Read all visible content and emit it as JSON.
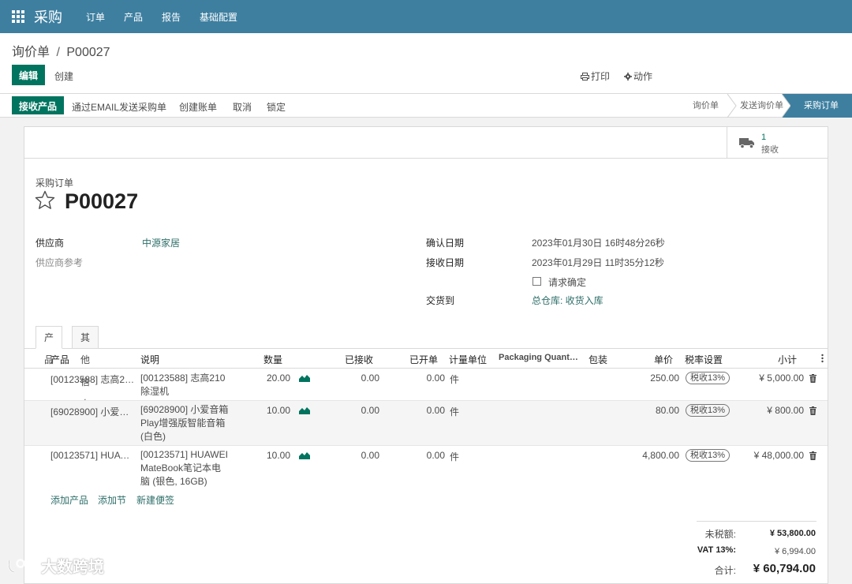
{
  "app": {
    "brand": "采购",
    "menu": [
      "订单",
      "产品",
      "报告",
      "基础配置"
    ]
  },
  "control": {
    "breadcrumb_parent": "询价单",
    "breadcrumb_sep": "/",
    "breadcrumb_current": "P00027",
    "edit_label": "编辑",
    "create_label": "创建",
    "print_label": "打印",
    "action_label": "动作"
  },
  "statusbar": {
    "buttons": [
      "接收产品",
      "通过EMAIL发送采购单",
      "创建账单",
      "取消",
      "锁定"
    ],
    "stages": [
      "询价单",
      "发送询价单",
      "采购订单"
    ],
    "active_stage": "采购订单"
  },
  "smart_button": {
    "count": "1",
    "label": "接收"
  },
  "form": {
    "doc_type": "采购订单",
    "doc_name": "P00027",
    "vendor_label": "供应商",
    "vendor_value": "中源家居",
    "vendor_ref_label": "供应商参考",
    "confirm_date_label": "确认日期",
    "confirm_date_value": "2023年01月30日 16时48分26秒",
    "receipt_date_label": "接收日期",
    "receipt_date_value": "2023年01月29日 11时35分12秒",
    "ask_confirm_label": "请求确定",
    "deliver_to_label": "交货到",
    "deliver_to_value": "总仓库: 收货入库"
  },
  "tabs": [
    "产品",
    "其他信息"
  ],
  "table": {
    "headers": [
      "产品",
      "说明",
      "数量",
      "已接收",
      "已开单",
      "计量单位",
      "Packaging Quant…",
      "包装",
      "单价",
      "税率设置",
      "小计"
    ],
    "rows": [
      {
        "product": "[00123588] 志高21…",
        "description": "[00123588] 志高210 除湿机",
        "qty": "20.00",
        "received": "0.00",
        "billed": "0.00",
        "uom": "件",
        "unit_price": "250.00",
        "tax": "税收13%",
        "subtotal": "¥ 5,000.00"
      },
      {
        "product": "[69028900] 小爱音…",
        "description": "[69028900] 小爱音箱Play增强版智能音箱 (白色)",
        "qty": "10.00",
        "received": "0.00",
        "billed": "0.00",
        "uom": "件",
        "unit_price": "80.00",
        "tax": "税收13%",
        "subtotal": "¥ 800.00"
      },
      {
        "product": "[00123571] HUAW…",
        "description": "[00123571] HUAWEI MateBook笔记本电脑 (银色, 16GB)",
        "qty": "10.00",
        "received": "0.00",
        "billed": "0.00",
        "uom": "件",
        "unit_price": "4,800.00",
        "tax": "税收13%",
        "subtotal": "¥ 48,000.00"
      }
    ],
    "add_product": "添加产品",
    "add_section": "添加节",
    "add_note": "新建便签"
  },
  "totals": {
    "untaxed_label": "未税额:",
    "untaxed_value": "¥ 53,800.00",
    "vat_label": "VAT 13%:",
    "vat_value": "¥ 6,994.00",
    "total_label": "合计:",
    "total_value": "¥ 60,794.00"
  },
  "watermark": "大数跨境",
  "colors": {
    "nav": "#3e7fa0",
    "primary": "#00745f",
    "link": "#2e6f6a"
  }
}
